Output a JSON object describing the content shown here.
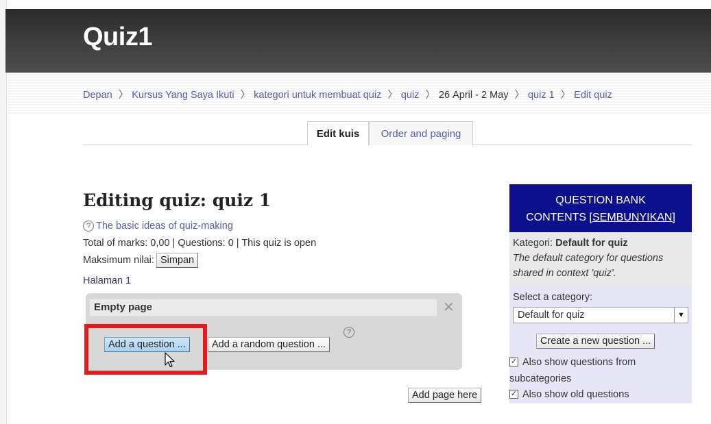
{
  "header": {
    "title": "Quiz1"
  },
  "breadcrumb": [
    {
      "label": "Depan",
      "link": true
    },
    {
      "label": "Kursus Yang Saya Ikuti",
      "link": true
    },
    {
      "label": "kategori untuk membuat quiz",
      "link": true
    },
    {
      "label": "quiz",
      "link": true
    },
    {
      "label": "26 April - 2 May",
      "link": false
    },
    {
      "label": "quiz 1",
      "link": true
    },
    {
      "label": "Edit quiz",
      "link": true
    }
  ],
  "tabs": [
    {
      "label": "Edit kuis",
      "active": true
    },
    {
      "label": "Order and paging",
      "active": false
    }
  ],
  "main": {
    "heading": "Editing quiz: quiz 1",
    "help_link": "The basic ideas of quiz-making",
    "marks_line": "Total of marks: 0,00 | Questions: 0 | This quiz is open",
    "max_grade_label": "Maksimum nilai:",
    "save_button": "Simpan",
    "page_label": "Halaman 1",
    "page_box_title": "Empty page",
    "add_question_button": "Add a question ...",
    "add_random_button": "Add a random question ...",
    "add_page_button": "Add page here"
  },
  "question_bank": {
    "header_line1": "QUESTION BANK",
    "header_line2": "CONTENTS",
    "hide_link": "[SEMBUNYIKAN]",
    "category_label": "Kategori:",
    "category_value": "Default for quiz",
    "category_desc": "The default category for questions shared in context 'quiz'.",
    "select_label": "Select a category:",
    "select_value": "Default for quiz",
    "create_button": "Create a new question ...",
    "checkbox_subcategories": "Also show questions from subcategories",
    "checkbox_old": "Also show old questions"
  },
  "colors": {
    "qbank_header": "#0d108c",
    "highlight_box": "#e31b1b",
    "link": "#5a5ab0"
  },
  "icons": {
    "help": "question-circle-icon",
    "close": "close-x-icon",
    "select": "chevron-down-icon",
    "cursor": "mouse-pointer-icon",
    "checkbox": "checkbox-checked-icon"
  }
}
